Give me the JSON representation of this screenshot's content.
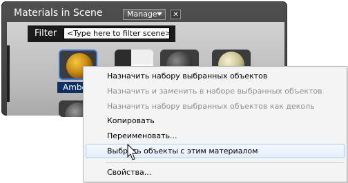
{
  "panel": {
    "title": "Materials in Scene",
    "manage_label": "Manage",
    "close_label": "✕",
    "filter_label": "Filter",
    "filter_placeholder": "<Type here to filter scene>"
  },
  "materials": {
    "selected_label": "Amber"
  },
  "context_menu": {
    "items": [
      {
        "label": "Назначить набору выбранных объектов",
        "enabled": true
      },
      {
        "label": "Назначить и заменить в наборе выбранных объектов",
        "enabled": false
      },
      {
        "label": "Назначить набору выбранных объектов как деколь",
        "enabled": false
      },
      {
        "label": "Копировать",
        "enabled": true
      },
      {
        "label": "Переименовать...",
        "enabled": true
      },
      {
        "label": "Выбрать объекты с этим материалом",
        "enabled": true,
        "highlighted": true
      },
      {
        "label": "Свойства...",
        "enabled": true
      }
    ]
  },
  "colors": {
    "selection_border": "#3a73c9",
    "menu_highlight": "#e3eefb",
    "disabled_text": "#8d8d8d"
  }
}
